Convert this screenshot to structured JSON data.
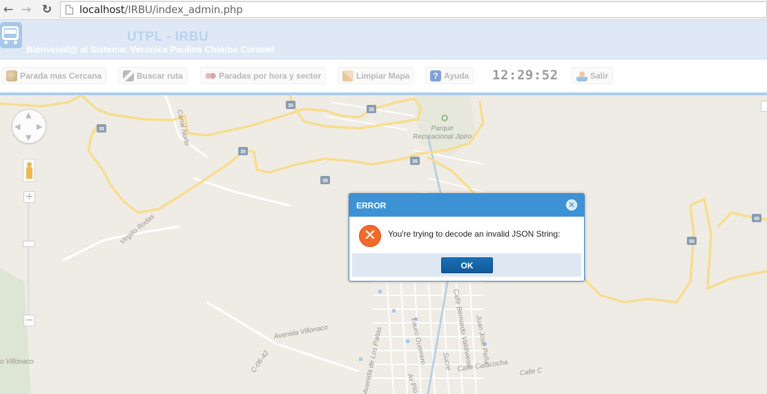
{
  "browser": {
    "url_host": "localhost",
    "url_path": "/IRBU/index_admin.php",
    "back_icon": "arrow-left-icon",
    "forward_icon": "arrow-right-icon",
    "reload_icon": "reload-icon"
  },
  "header": {
    "title": "UTPL - IRBU",
    "welcome": "Bienvenid@ al Sistema: Veronica Paulina Chimbo Coronel",
    "logo_icon": "bus-icon"
  },
  "toolbar": {
    "buttons": [
      {
        "label": "Parada mas Cercana",
        "icon": "bus-stop-icon"
      },
      {
        "label": "Buscar ruta",
        "icon": "route-search-icon"
      },
      {
        "label": "Paradas por hora y sector",
        "icon": "binoculars-icon"
      },
      {
        "label": "Limpiar Mapa",
        "icon": "eraser-icon"
      },
      {
        "label": "Ayuda",
        "icon": "help-icon"
      },
      {
        "label": "Salir",
        "icon": "user-logout-icon"
      }
    ],
    "clock": "12:29:52"
  },
  "map": {
    "labels": {
      "park": "Parque\nRecreacional Jipiro",
      "road_35": "35",
      "road_50": "50",
      "road_45": "45",
      "canal_norte": "Canal Norte",
      "virgilio_rodas": "Virgilio Rodas",
      "avenida_villonaco": "Avenida Villonaco",
      "villonaco": "o Villonaco",
      "c0642": "C-06-42",
      "av_los_paltas": "Avenida de Los Paltas",
      "lauro_guerrero": "Lauro Guerrero",
      "av_pio": "Av Pío",
      "sucre": "Sucre",
      "bernardo": "Calle Bernardo Valdivieso",
      "juan_jose_pena": "Juan Jose Peña",
      "catacocha": "Calle Catacocha",
      "calle_c": "Calle C"
    }
  },
  "dialog": {
    "title": "ERROR",
    "message": "You're trying to decode an invalid JSON String:",
    "ok_label": "OK",
    "icon": "error-icon",
    "close_icon": "close-icon"
  },
  "colors": {
    "header_bg": "#dfe9f5",
    "dialog_title_bg": "#3d92d6",
    "ok_button": "#1a6fb6",
    "error_icon": "#f26a2a",
    "map_bg": "#efece6",
    "highway": "#f7dd8f"
  }
}
